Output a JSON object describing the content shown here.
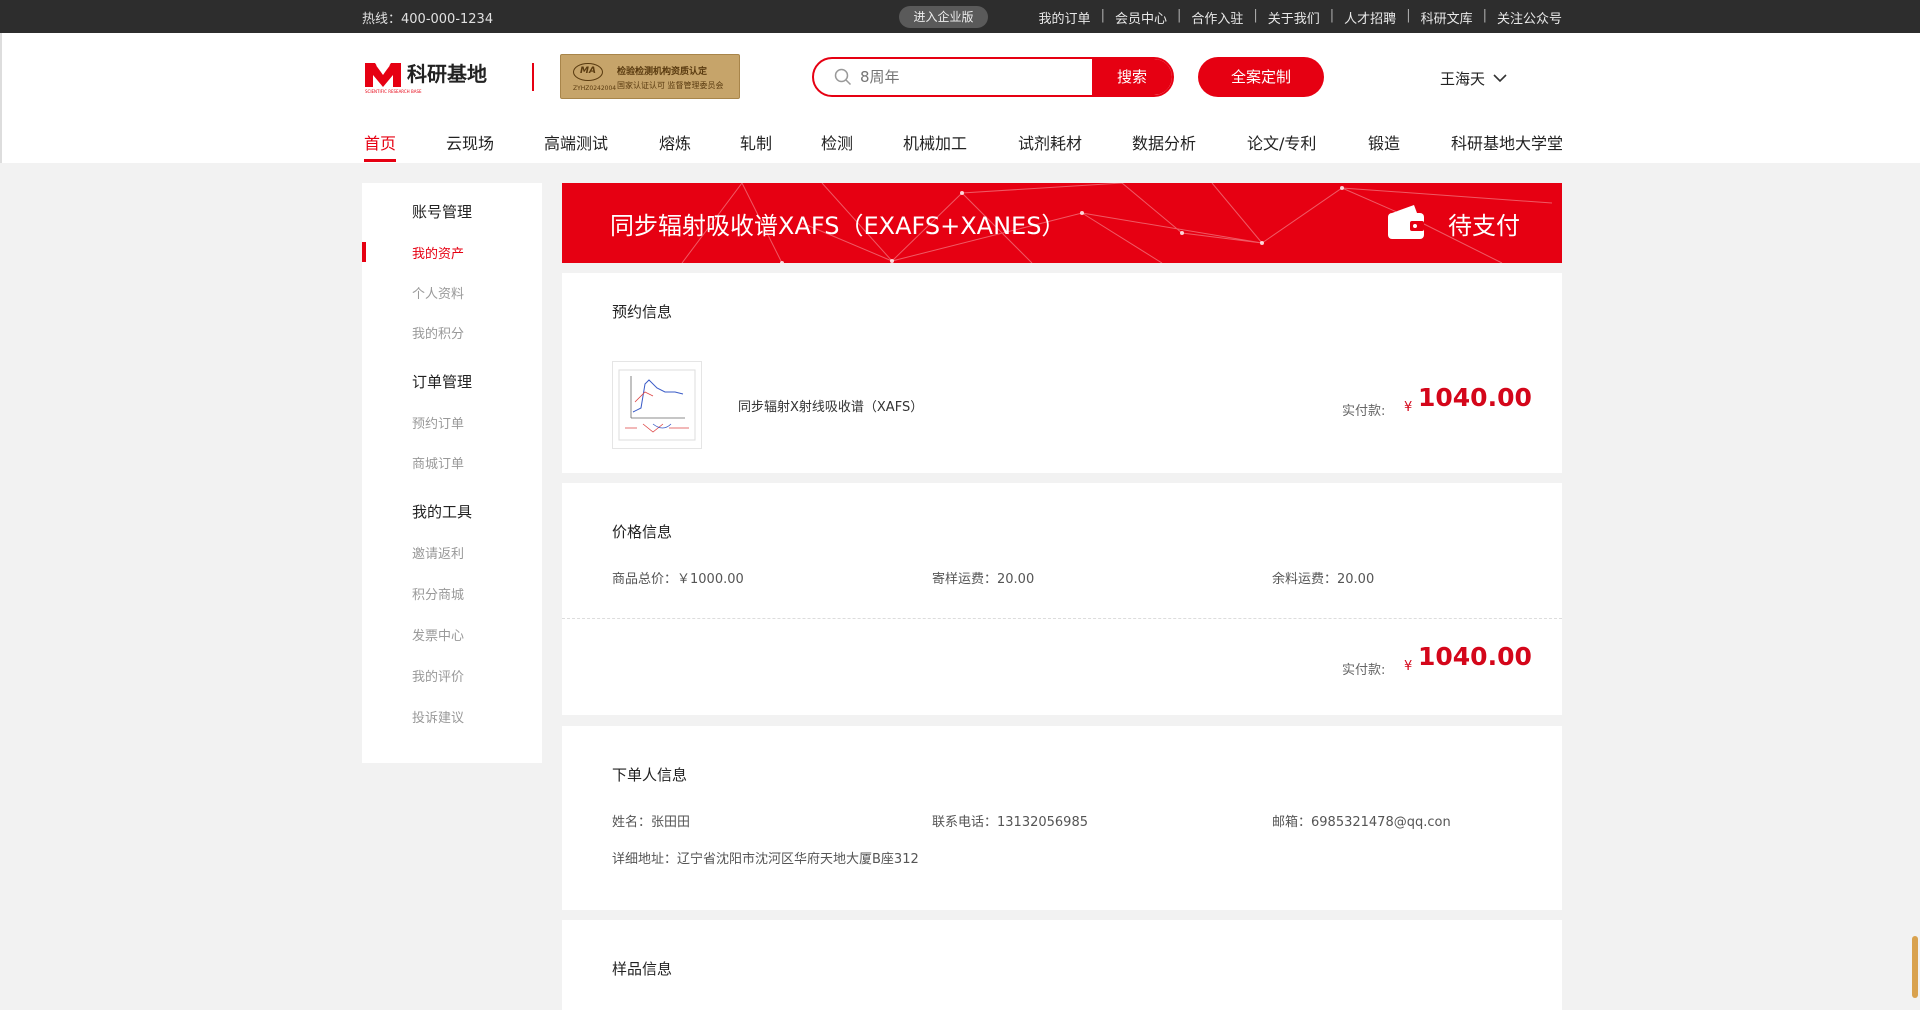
{
  "topbar": {
    "hotline": "热线：400-000-1234",
    "enterprise": "进入企业版",
    "links": [
      "我的订单",
      "会员中心",
      "合作入驻",
      "关于我们",
      "人才招聘",
      "科研文库",
      "关注公众号"
    ],
    "separator": "|"
  },
  "header": {
    "logo_text": "科研基地",
    "logo_sub": "SCIENTIFIC RESEARCH BASE",
    "cma": {
      "mark": "MA",
      "line1": "检验检测机构资质认定",
      "line2": "国家认证认可 监督管理委员会",
      "line3": "ZYHZ0242004"
    },
    "search_placeholder": "8周年",
    "search_button": "搜索",
    "custom_button": "全案定制",
    "user_name": "王海天"
  },
  "nav": [
    "首页",
    "云现场",
    "高端测试",
    "熔炼",
    "轧制",
    "检测",
    "机械加工",
    "试剂耗材",
    "数据分析",
    "论文/专利",
    "锻造",
    "科研基地大学堂"
  ],
  "sidebar": [
    {
      "label": "账号管理",
      "type": "head"
    },
    {
      "label": "我的资产",
      "type": "sub",
      "active": true
    },
    {
      "label": "个人资料",
      "type": "sub"
    },
    {
      "label": "我的积分",
      "type": "sub"
    },
    {
      "label": "订单管理",
      "type": "head"
    },
    {
      "label": "预约订单",
      "type": "sub"
    },
    {
      "label": "商城订单",
      "type": "sub"
    },
    {
      "label": "我的工具",
      "type": "head"
    },
    {
      "label": "邀请返利",
      "type": "sub"
    },
    {
      "label": "积分商城",
      "type": "sub"
    },
    {
      "label": "发票中心",
      "type": "sub"
    },
    {
      "label": "我的评价",
      "type": "sub"
    },
    {
      "label": "投诉建议",
      "type": "sub"
    }
  ],
  "banner": {
    "title": "同步辐射吸收谱XAFS（EXAFS+XANES）",
    "status": "待支付"
  },
  "reservation": {
    "title": "预约信息",
    "product": "同步辐射X射线吸收谱（XAFS）",
    "paid_label": "实付款:",
    "yen": "¥",
    "amount": "1040.00"
  },
  "price": {
    "title": "价格信息",
    "total": "商品总价：￥1000.00",
    "shipping": "寄样运费：20.00",
    "return_shipping": "余料运费：20.00",
    "paid_label": "实付款:",
    "yen": "¥",
    "amount": "1040.00"
  },
  "orderer": {
    "title": "下单人信息",
    "name": "姓名：张田田",
    "phone": "联系电话：13132056985",
    "email": "邮箱：6985321478@qq.con",
    "address": "详细地址：辽宁省沈阳市沈河区华府天地大厦B座312"
  },
  "sample": {
    "title": "样品信息"
  },
  "colors": {
    "brand_red": "#e60012",
    "price_red": "#d4061a",
    "topbar_bg": "#2d2d2d",
    "page_bg": "#f2f2f2"
  }
}
